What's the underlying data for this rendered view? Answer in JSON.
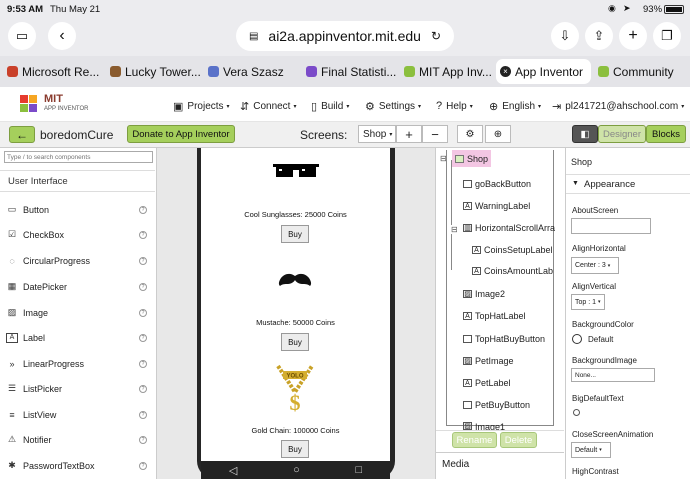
{
  "status": {
    "time": "9:53 AM",
    "date": "Thu May 21",
    "battery": "93%"
  },
  "browser": {
    "url": "ai2a.appinventor.mit.edu"
  },
  "tabs": [
    {
      "label": "Microsoft Re...",
      "color": "#c9402a"
    },
    {
      "label": "Lucky Tower...",
      "color": "#8a5b2e"
    },
    {
      "label": "Vera Szasz",
      "color": "#5a72c9"
    },
    {
      "label": "Final Statisti...",
      "color": "#7b4bc9"
    },
    {
      "label": "MIT App Inv...",
      "color": "#8bbf3e"
    },
    {
      "label": "App Inventor",
      "color": "#222222",
      "active": true
    },
    {
      "label": "Community",
      "color": "#8bbf3e"
    }
  ],
  "appinventor": {
    "logo_top": "MIT",
    "logo_bottom": "APP INVENTOR",
    "menu": {
      "projects": "Projects",
      "connect": "Connect",
      "build": "Build",
      "settings": "Settings",
      "help": "Help",
      "language": "English",
      "account": "pl241721@ahschool.com"
    },
    "project_name": "boredomCure",
    "donate": "Donate to App Inventor",
    "screens_label": "Screens:",
    "screen_select": "Shop",
    "designer": "Designer",
    "blocks": "Blocks"
  },
  "palette": {
    "search_placeholder": "Type / to search components",
    "category": "User Interface",
    "items": [
      "Button",
      "CheckBox",
      "CircularProgress",
      "DatePicker",
      "Image",
      "Label",
      "LinearProgress",
      "ListPicker",
      "ListView",
      "Notifier",
      "PasswordTextBox"
    ]
  },
  "viewer": {
    "items": [
      {
        "caption": "Cool Sunglasses: 25000 Coins",
        "button": "Buy"
      },
      {
        "caption": "Mustache: 50000 Coins",
        "button": "Buy"
      },
      {
        "caption": "Gold Chain: 100000 Coins",
        "button": "Buy"
      }
    ],
    "chain_text": "YOLO",
    "chain_symbol": "$"
  },
  "components": {
    "root": "Shop",
    "items": [
      "goBackButton",
      "WarningLabel",
      "HorizontalScrollArra",
      "CoinsSetupLabel",
      "CoinsAmountLab",
      "Image2",
      "TopHatLabel",
      "TopHatBuyButton",
      "PetImage",
      "PetLabel",
      "PetBuyButton",
      "Image1"
    ],
    "rename": "Rename",
    "delete": "Delete",
    "media": "Media"
  },
  "properties": {
    "component": "Shop",
    "section": "Appearance",
    "about_screen": "AboutScreen",
    "align_horizontal": "AlignHorizontal",
    "align_horizontal_value": "Center : 3",
    "align_vertical": "AlignVertical",
    "align_vertical_value": "Top : 1",
    "background_color": "BackgroundColor",
    "background_color_value": "Default",
    "background_image": "BackgroundImage",
    "background_image_value": "None...",
    "big_default_text": "BigDefaultText",
    "close_screen_animation": "CloseScreenAnimation",
    "close_screen_animation_value": "Default",
    "high_contrast": "HighContrast"
  }
}
